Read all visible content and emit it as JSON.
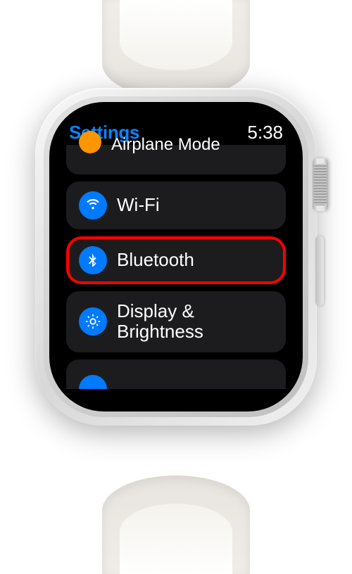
{
  "header": {
    "title": "Settings",
    "time": "5:38"
  },
  "items": {
    "airplane": {
      "label": "Airplane Mode",
      "icon_name": "airplane-icon",
      "color": "orange"
    },
    "wifi": {
      "label": "Wi-Fi",
      "icon_name": "wifi-icon",
      "color": "blue"
    },
    "bluetooth": {
      "label": "Bluetooth",
      "icon_name": "bluetooth-icon",
      "color": "blue"
    },
    "display": {
      "label": "Display & Brightness",
      "icon_name": "brightness-icon",
      "color": "blue"
    }
  },
  "highlight": "bluetooth",
  "colors": {
    "accent": "#0a84ff",
    "item_bg": "#1c1c1e",
    "highlight_border": "#ff0000"
  }
}
